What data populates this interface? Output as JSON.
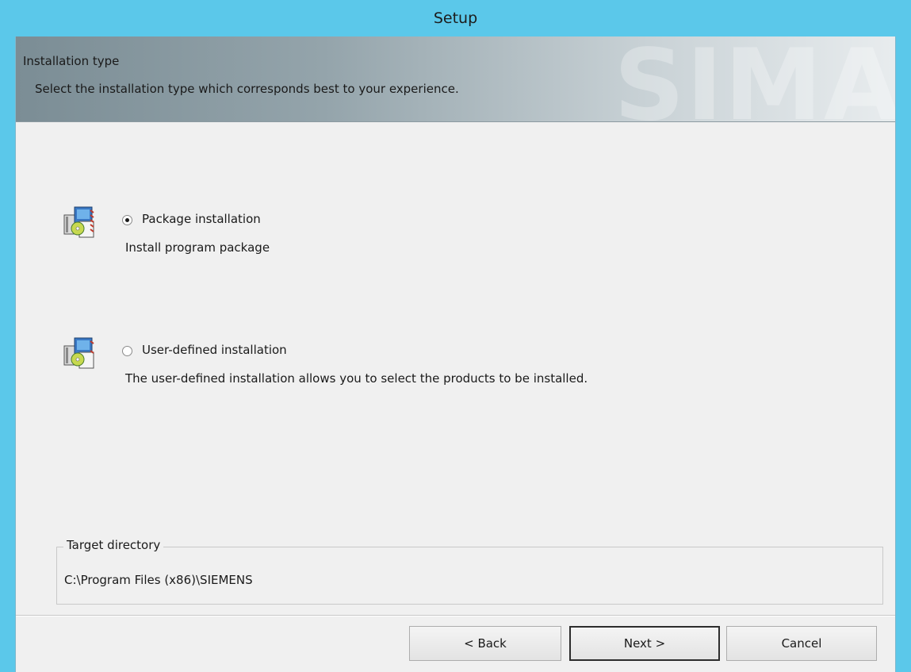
{
  "window": {
    "title": "Setup"
  },
  "header": {
    "title": "Installation type",
    "subtitle": "Select the installation type which corresponds best to your experience.",
    "watermark": "SIMA"
  },
  "options": [
    {
      "label": "Package installation",
      "description": "Install program package",
      "selected": true,
      "icon": "package-install-icon"
    },
    {
      "label": "User-defined installation",
      "description": "The user-defined installation allows you to select the products to be installed.",
      "selected": false,
      "icon": "custom-install-icon"
    }
  ],
  "target": {
    "legend": "Target directory",
    "path": "C:\\Program Files (x86)\\SIEMENS"
  },
  "buttons": {
    "back": "< Back",
    "next": "Next >",
    "cancel": "Cancel"
  },
  "colors": {
    "titlebar": "#5bc8ea",
    "client": "#f0f0f0",
    "header_dark": "#7b8d95",
    "header_light": "#e8ecee"
  }
}
